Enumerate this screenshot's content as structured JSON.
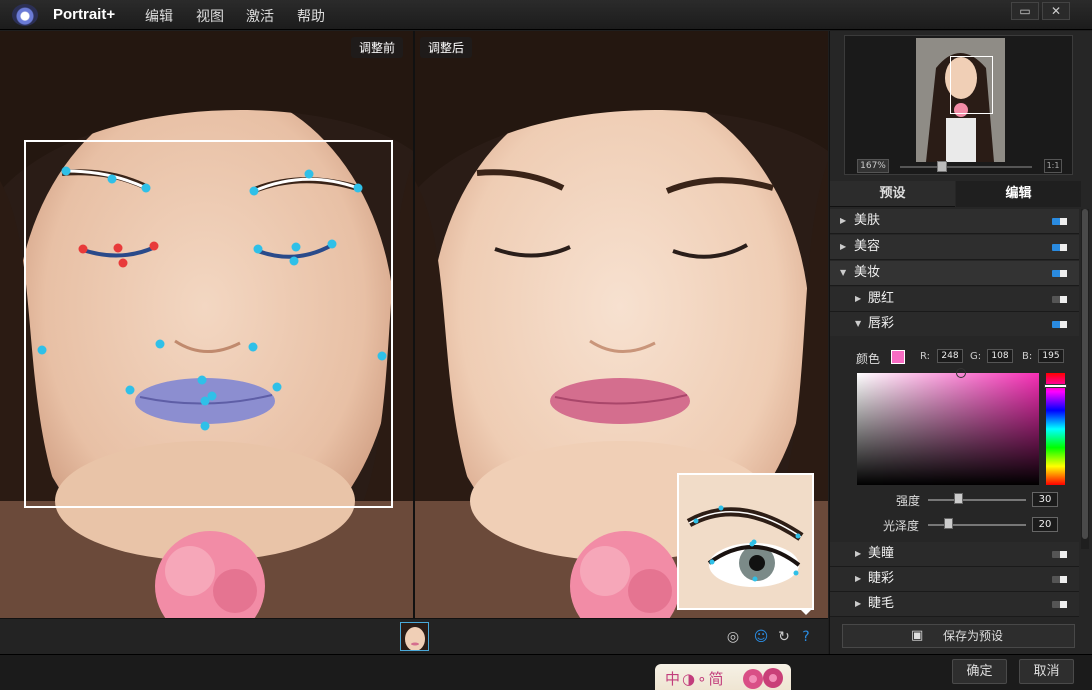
{
  "app": {
    "title": "Portrait+",
    "menu": [
      "编辑",
      "视图",
      "激活",
      "帮助"
    ],
    "window_buttons": {
      "restore": "▭",
      "close": "✕"
    }
  },
  "canvas": {
    "before_label": "调整前",
    "after_label": "调整后"
  },
  "navigator": {
    "zoom_level": "167%",
    "zoom_slider_fraction": 0.3,
    "actual_size_label": "1:1"
  },
  "tabs": {
    "preset": "预设",
    "edit": "编辑",
    "active": "edit"
  },
  "accordion": {
    "top": [
      {
        "label": "美肤",
        "expanded": false,
        "enabled": true
      },
      {
        "label": "美容",
        "expanded": false,
        "enabled": true
      },
      {
        "label": "美妆",
        "expanded": true,
        "enabled": true
      }
    ],
    "makeup_items": [
      {
        "label": "腮红",
        "expanded": false,
        "enabled": false
      },
      {
        "label": "唇彩",
        "expanded": true,
        "enabled": true
      }
    ],
    "lower_items": [
      {
        "label": "美瞳",
        "enabled": false
      },
      {
        "label": "睫彩",
        "enabled": false
      },
      {
        "label": "睫毛",
        "enabled": false
      }
    ]
  },
  "lip_color": {
    "color_label": "颜色",
    "swatch": "#f86cc3",
    "r_label": "R:",
    "r": "248",
    "g_label": "G:",
    "g": "108",
    "b_label": "B:",
    "b": "195",
    "strength_label": "强度",
    "strength": "30",
    "gloss_label": "光泽度",
    "gloss": "20"
  },
  "save_preset_label": "保存为预设",
  "footer": {
    "ok": "确定",
    "cancel": "取消"
  },
  "watermark": {
    "text": "中◑∘简"
  },
  "colors": {
    "accent": "#2a8be0",
    "landmark": "#2fc0e8",
    "landmark_selected": "#e83a3a"
  }
}
